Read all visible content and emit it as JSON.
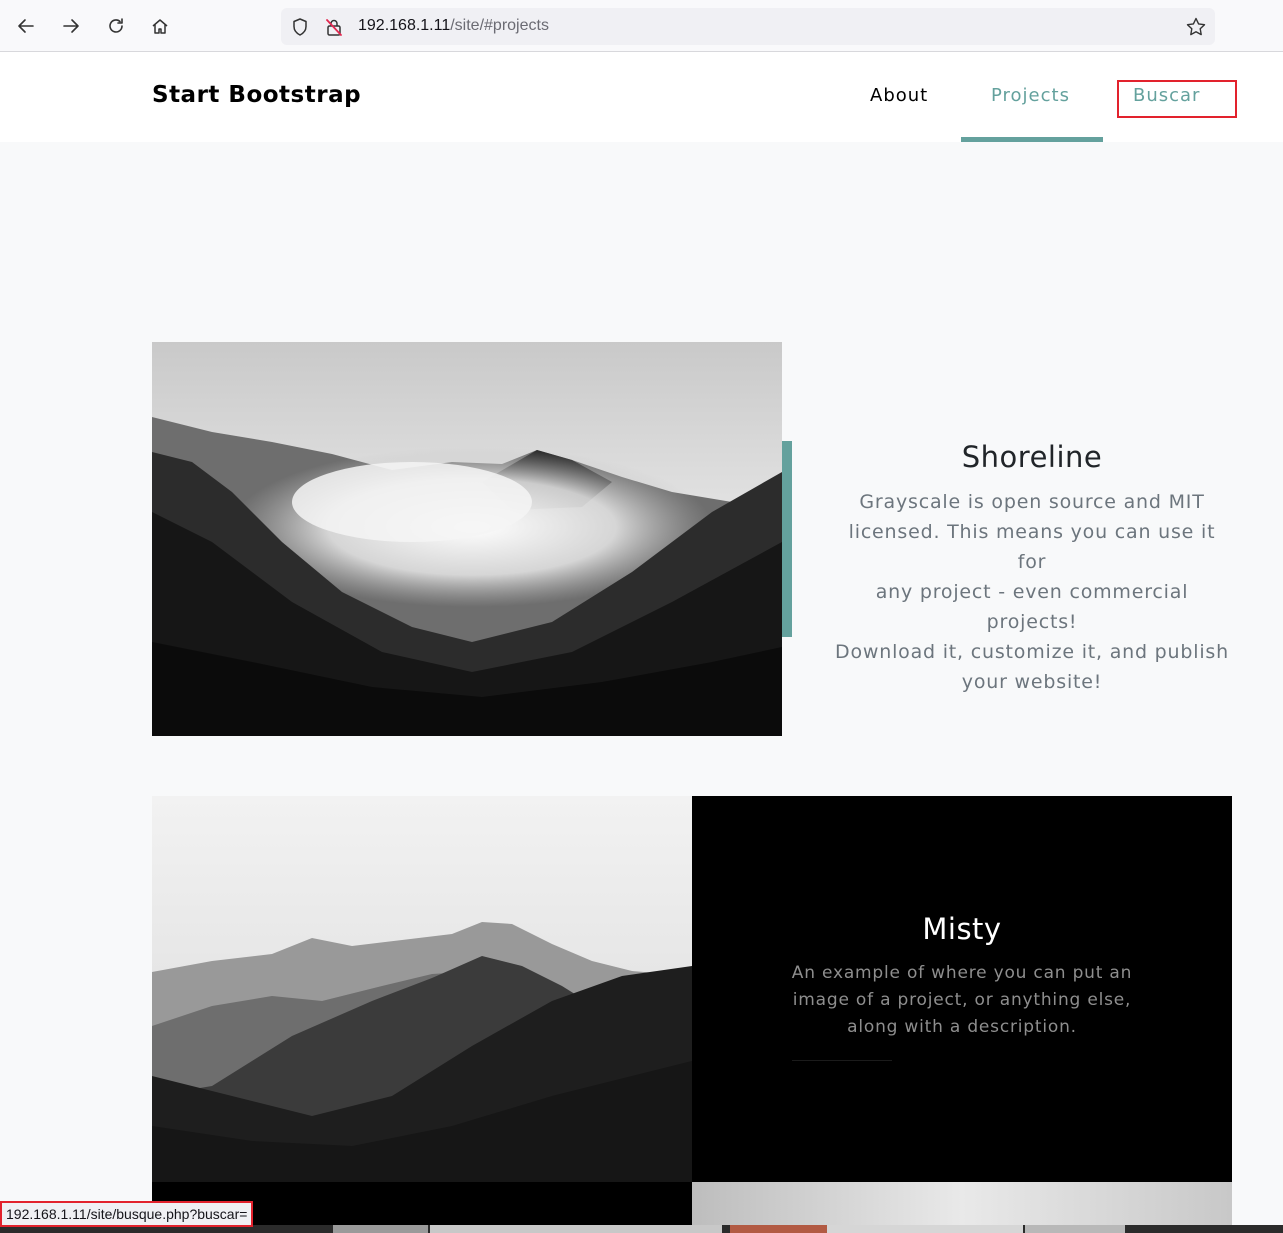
{
  "browser": {
    "url_host": "192.168.1.11",
    "url_path": "/site/#projects"
  },
  "navbar": {
    "brand": "Start Bootstrap",
    "links": [
      {
        "label": "About"
      },
      {
        "label": "Projects",
        "active": true
      },
      {
        "label": "Buscar",
        "highlighted": true
      }
    ]
  },
  "projects": [
    {
      "title": "Shoreline",
      "description_lines": [
        "Grayscale is open source and MIT",
        "licensed. This means you can use it for",
        "any project - even commercial projects!",
        "Download it, customize it, and publish",
        "your website!"
      ]
    },
    {
      "title": "Misty",
      "description_lines": [
        "An example of where you can put an",
        "image of a project, or anything else,",
        "along with a description."
      ]
    }
  ],
  "status_bar": {
    "text": "192.168.1.11/site/busque.php?buscar="
  },
  "colors": {
    "accent": "#64a19d",
    "highlight": "#e2222d"
  }
}
